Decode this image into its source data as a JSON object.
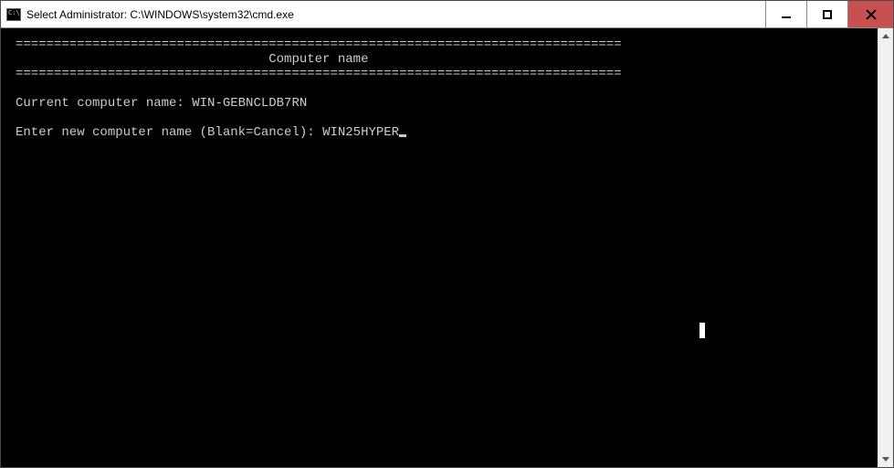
{
  "window": {
    "title": "Select Administrator: C:\\WINDOWS\\system32\\cmd.exe"
  },
  "console": {
    "rule": "===============================================================================",
    "header_spaces": "                                 ",
    "header": "Computer name",
    "blank": "",
    "current_label": "Current computer name: ",
    "current_value": "WIN-GEBNCLDB7RN",
    "prompt_label": "Enter new computer name (Blank=Cancel): ",
    "prompt_value": "WIN25HYPER"
  }
}
